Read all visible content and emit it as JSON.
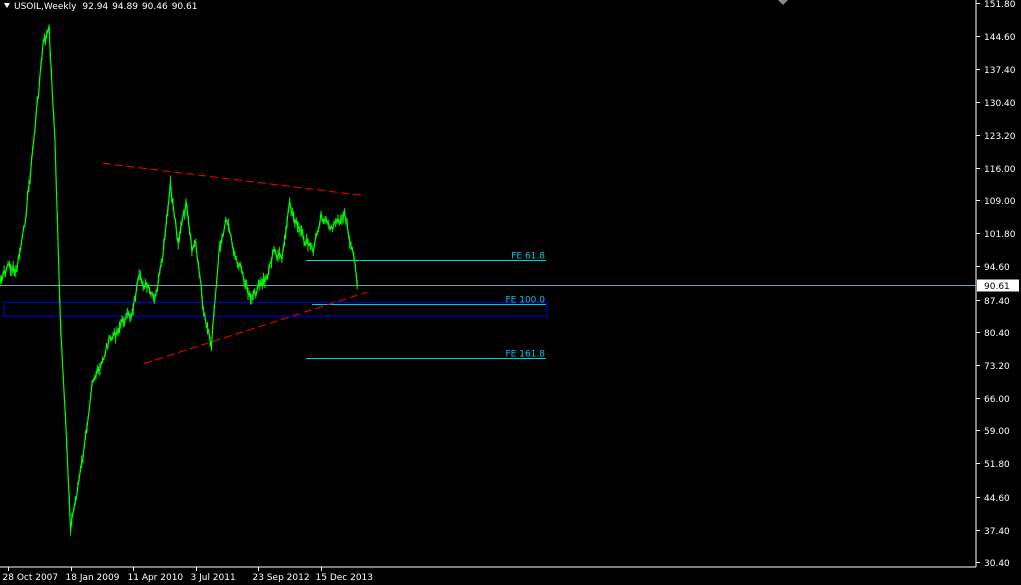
{
  "header": {
    "symbol": "USOIL,Weekly",
    "open": "92.94",
    "high": "94.89",
    "low": "90.46",
    "close": "90.61"
  },
  "colors": {
    "background": "#000000",
    "bars": "#00ff00",
    "trendline": "#ff0000",
    "fibo": "#00c8e6",
    "zone": "#0000ff",
    "axis": "#ffffff",
    "price_line": "#5fa6c8"
  },
  "chart_data": {
    "type": "line",
    "symbol": "USOIL",
    "timeframe": "Weekly",
    "x_ticks": [
      "28 Oct 2007",
      "18 Jan 2009",
      "11 Apr 2010",
      "3 Jul 2011",
      "23 Sep 2012",
      "15 Dec 2013"
    ],
    "y_ticks": [
      "151.80",
      "144.60",
      "137.40",
      "130.40",
      "123.20",
      "116.00",
      "109.00",
      "101.80",
      "94.60",
      "87.40",
      "80.40",
      "73.20",
      "66.00",
      "59.00",
      "51.80",
      "44.60",
      "37.40",
      "30.40"
    ],
    "ylim": [
      30.4,
      151.8
    ],
    "current_price": "90.61",
    "series": [
      {
        "x": [
          "2007-08-05",
          "2007-09-02",
          "2007-10-28",
          "2007-12-23",
          "2008-02-17",
          "2008-04-13",
          "2008-05-25",
          "2008-07-06",
          "2008-08-17",
          "2008-09-28",
          "2008-11-09",
          "2008-12-21",
          "2009-01-18",
          "2009-03-01",
          "2009-04-26",
          "2009-06-21",
          "2009-08-16",
          "2009-10-11",
          "2009-12-06",
          "2010-01-31",
          "2010-03-28",
          "2010-04-11",
          "2010-05-23",
          "2010-07-18",
          "2010-09-12",
          "2010-11-07",
          "2011-01-02",
          "2011-02-27",
          "2011-04-24",
          "2011-06-05",
          "2011-07-03",
          "2011-08-28",
          "2011-10-23",
          "2011-12-18",
          "2012-02-12",
          "2012-04-08",
          "2012-06-03",
          "2012-07-29",
          "2012-09-23",
          "2012-11-18",
          "2013-01-13",
          "2013-03-10",
          "2013-05-05",
          "2013-06-30",
          "2013-08-25",
          "2013-10-20",
          "2013-12-15",
          "2014-02-09",
          "2014-04-06",
          "2014-06-01",
          "2014-07-27",
          "2014-08-17",
          "2014-08-31"
        ],
        "y": [
          88,
          91,
          95,
          93,
          102,
          117,
          130,
          143,
          146,
          122,
          80,
          56,
          38,
          45,
          55,
          70,
          72,
          78,
          80,
          83,
          84,
          86,
          92,
          90,
          87,
          96,
          112,
          100,
          108,
          98,
          100,
          85,
          78,
          99,
          105,
          97,
          93,
          87,
          90,
          92,
          98,
          96,
          108,
          103,
          100,
          98,
          106,
          103,
          104,
          106,
          98,
          95,
          90.61
        ]
      }
    ],
    "trendlines": [
      {
        "name": "upper",
        "x": [
          "2009-09-06",
          "2014-10-12"
        ],
        "y": [
          117,
          110
        ]
      },
      {
        "name": "lower",
        "x": [
          "2010-06-27",
          "2014-11-09"
        ],
        "y": [
          73.5,
          89
        ]
      }
    ],
    "fibo_levels": [
      {
        "label": "FE 61.8",
        "value": 96.0
      },
      {
        "label": "FE 100.0",
        "value": 86.5
      },
      {
        "label": "FE 161.8",
        "value": 74.8
      }
    ],
    "zone": {
      "high": 86.8,
      "low": 83.8
    }
  }
}
